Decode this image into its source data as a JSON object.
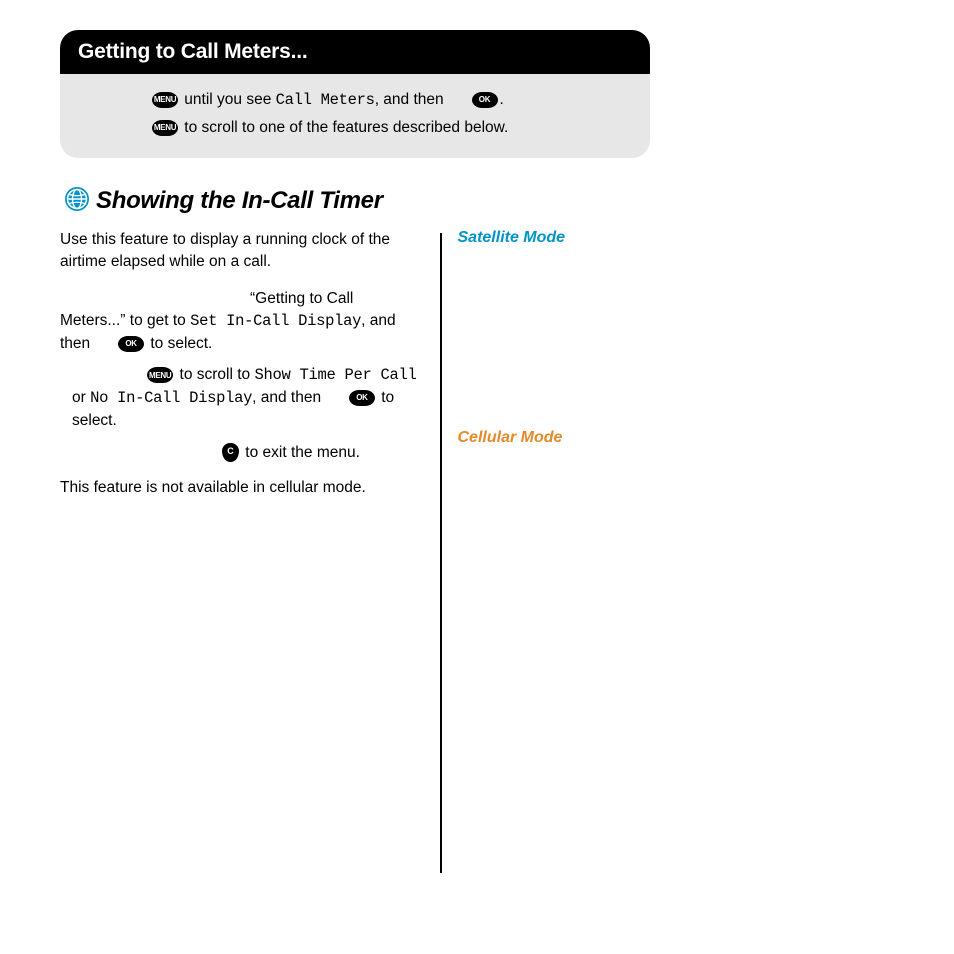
{
  "header": {
    "title": "Getting to Call Meters..."
  },
  "subbox": {
    "line1_a": " until you see ",
    "line1_menu": "Call Meters",
    "line1_b": ", and then ",
    "line1_c": ".",
    "line2": " to scroll to one of the features described below."
  },
  "keys": {
    "menu": "MENU",
    "ok": "OK",
    "c": "C"
  },
  "section": {
    "title": "Showing the In-Call Timer"
  },
  "left": {
    "intro": "Use this feature to display a running clock of the airtime elapsed while on a call.",
    "s1_a": "“Getting to Call Meters...” to get to ",
    "s1_menu": "Set In-Call Display",
    "s1_b": ", and then ",
    "s1_c": " to select.",
    "s2_a": " to scroll to ",
    "s2_m1": "Show Time Per Call",
    "s2_b": " or ",
    "s2_m2": "No In-Call Display",
    "s2_c": ", and then ",
    "s2_d": " to select.",
    "s3": " to exit the menu.",
    "note": "This feature is not available in cellular mode."
  },
  "right": {
    "sat": "Satellite Mode",
    "cell": "Cellular Mode"
  }
}
